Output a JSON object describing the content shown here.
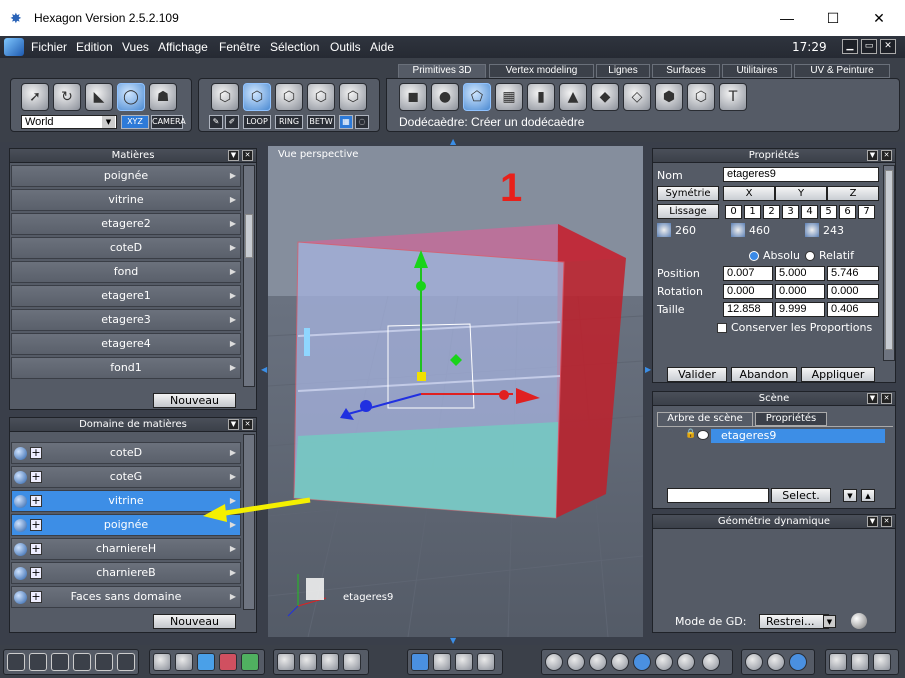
{
  "window": {
    "title": "Hexagon Version 2.5.2.109",
    "minimize": "—",
    "maximize": "☐",
    "close": "✕"
  },
  "menu": [
    "Fichier",
    "Edition",
    "Vues",
    "Affichage",
    "Fenêtre",
    "Sélection",
    "Outils",
    "Aide"
  ],
  "clock": "17:29",
  "toolbar": {
    "world": "World",
    "xyz": "XYZ",
    "camera": "CAMERA",
    "loop": "LOOP",
    "ring": "RING",
    "betw": "BETW"
  },
  "tabs": [
    "Primitives 3D",
    "Vertex modeling",
    "Lignes",
    "Surfaces",
    "Utilitaires",
    "UV & Peinture"
  ],
  "status_text": "Dodécaèdre: Créer un dodécaèdre",
  "matieres": {
    "title": "Matières",
    "items": [
      "poignée",
      "vitrine",
      "etagere2",
      "coteD",
      "fond",
      "etagere1",
      "etagere3",
      "etagere4",
      "fond1"
    ],
    "new_button": "Nouveau"
  },
  "domaine": {
    "title": "Domaine de matières",
    "items": [
      "coteD",
      "coteG",
      "vitrine",
      "poignée",
      "charniereH",
      "charniereB",
      "Faces sans domaine"
    ],
    "highlighted": [
      "vitrine",
      "poignée"
    ],
    "new_button": "Nouveau"
  },
  "viewport": {
    "label": "Vue perspective",
    "object_label": "etageres9",
    "annotation": "1"
  },
  "proprietes": {
    "title": "Propriétés",
    "nom_label": "Nom",
    "nom_value": "etageres9",
    "symetrie": "Symétrie",
    "lissage": "Lissage",
    "axes": [
      "X",
      "Y",
      "Z"
    ],
    "lissage_levels": [
      "0",
      "1",
      "2",
      "3",
      "4",
      "5",
      "6",
      "7"
    ],
    "counts": [
      "260",
      "460",
      "243"
    ],
    "absolu": "Absolu",
    "relatif": "Relatif",
    "position_label": "Position",
    "position": [
      "0.007",
      "5.000",
      "5.746"
    ],
    "rotation_label": "Rotation",
    "rotation": [
      "0.000",
      "0.000",
      "0.000"
    ],
    "taille_label": "Taille",
    "taille": [
      "12.858",
      "9.999",
      "0.406"
    ],
    "conserver": "Conserver les Proportions",
    "valider": "Valider",
    "abandon": "Abandon",
    "appliquer": "Appliquer"
  },
  "scene": {
    "title": "Scène",
    "tab_arbre": "Arbre de scène",
    "tab_props": "Propriétés",
    "item": "etageres9",
    "select": "Select."
  },
  "geometrie": {
    "title": "Géométrie dynamique",
    "mode_label": "Mode de GD:",
    "mode_value": "Restrei..."
  }
}
